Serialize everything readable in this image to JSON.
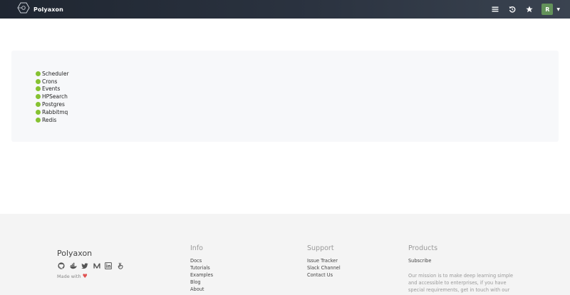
{
  "header": {
    "brand": "Polyaxon",
    "avatar_initial": "R",
    "icons": [
      "list-icon",
      "history-icon",
      "star-icon",
      "caret-down-icon"
    ]
  },
  "services": [
    {
      "name": "Scheduler",
      "status_color": "#86c232"
    },
    {
      "name": "Crons",
      "status_color": "#86c232"
    },
    {
      "name": "Events",
      "status_color": "#86c232"
    },
    {
      "name": "HPSearch",
      "status_color": "#86c232"
    },
    {
      "name": "Postgres",
      "status_color": "#86c232"
    },
    {
      "name": "Rabbitmq",
      "status_color": "#86c232"
    },
    {
      "name": "Redis",
      "status_color": "#86c232"
    }
  ],
  "footer": {
    "brand": "Polyaxon",
    "made_with": "Made with",
    "social_icons": [
      "github-icon",
      "docker-icon",
      "twitter-icon",
      "medium-icon",
      "linkedin-icon",
      "slack-icon"
    ],
    "info": {
      "title": "Info",
      "links": [
        "Docs",
        "Tutorials",
        "Examples",
        "Blog",
        "About"
      ]
    },
    "support": {
      "title": "Support",
      "links": [
        "Issue Tracker",
        "Slack Channel",
        "Contact Us"
      ]
    },
    "products": {
      "title": "Products",
      "links": [
        "Subscribe"
      ],
      "mission": "Our mission is to make deep learning simple and accessible to enterprises, if you have special requirements, get in touch with our team."
    }
  },
  "colors": {
    "header_bg": "#1f2631",
    "status_ok": "#86c232",
    "avatar_bg": "#63925a",
    "heart": "#e05252"
  }
}
